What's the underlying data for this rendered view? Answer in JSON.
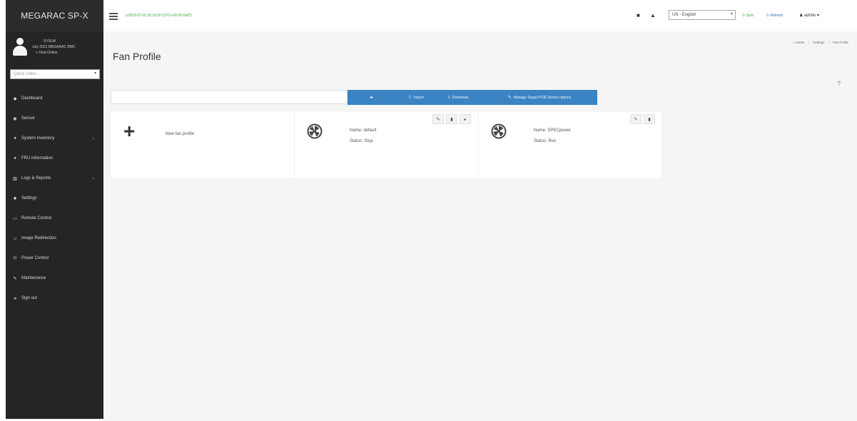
{
  "sidebar": {
    "brand": "MEGARAC SP-X",
    "user": {
      "hostname": "SYSLW",
      "firmware": "July 2021 MEGARAC BMC",
      "status": "Host Online"
    },
    "quick_links_placeholder": "Quick Links...",
    "nav": [
      {
        "label": "Dashboard",
        "icon": "dashboard-icon",
        "glyph": "◆",
        "has_arrow": false
      },
      {
        "label": "Sensor",
        "icon": "sensor-icon",
        "glyph": "◉",
        "has_arrow": false
      },
      {
        "label": "System Inventory",
        "icon": "inventory-icon",
        "glyph": "●",
        "has_arrow": true
      },
      {
        "label": "FRU Information",
        "icon": "info-icon",
        "glyph": "●",
        "has_arrow": false
      },
      {
        "label": "Logs & Reports",
        "icon": "chart-icon",
        "glyph": "▥",
        "has_arrow": true
      },
      {
        "label": "Settings",
        "icon": "gear-icon",
        "glyph": "✹",
        "has_arrow": false
      },
      {
        "label": "Remote Control",
        "icon": "monitor-icon",
        "glyph": "▭",
        "has_arrow": false
      },
      {
        "label": "Image Redirection",
        "icon": "image-icon",
        "glyph": "▱",
        "has_arrow": false
      },
      {
        "label": "Power Control",
        "icon": "power-icon",
        "glyph": "⏻",
        "has_arrow": false
      },
      {
        "label": "Maintenance",
        "icon": "wrench-icon",
        "glyph": "✎",
        "has_arrow": false
      },
      {
        "label": "Sign out",
        "icon": "sign-out-icon",
        "glyph": "➜",
        "has_arrow": false
      }
    ]
  },
  "topbar": {
    "datetime": "2023-07-10 15:18:20 (UTC+00:00 GMT)",
    "language": "US - English",
    "sync_label": "Sync",
    "refresh_label": "Refresh",
    "user_label": "admin"
  },
  "page": {
    "title": "Fan Profile",
    "breadcrumb": [
      "Home",
      "Settings",
      "Fan Profile"
    ]
  },
  "toolbar": {
    "import_label": "Import",
    "download_label": "Download",
    "manage_label": "Manage Target PCIE Device options"
  },
  "cards": {
    "new_label": "New fan profile",
    "profiles": [
      {
        "name": "Name: default",
        "status": "Status: Stop"
      },
      {
        "name": "Name: SPECpower",
        "status": "Status: Run"
      }
    ]
  },
  "colors": {
    "sidebar_bg": "#252525",
    "accent_blue": "#3b84c4",
    "status_green": "#3aa53a"
  }
}
